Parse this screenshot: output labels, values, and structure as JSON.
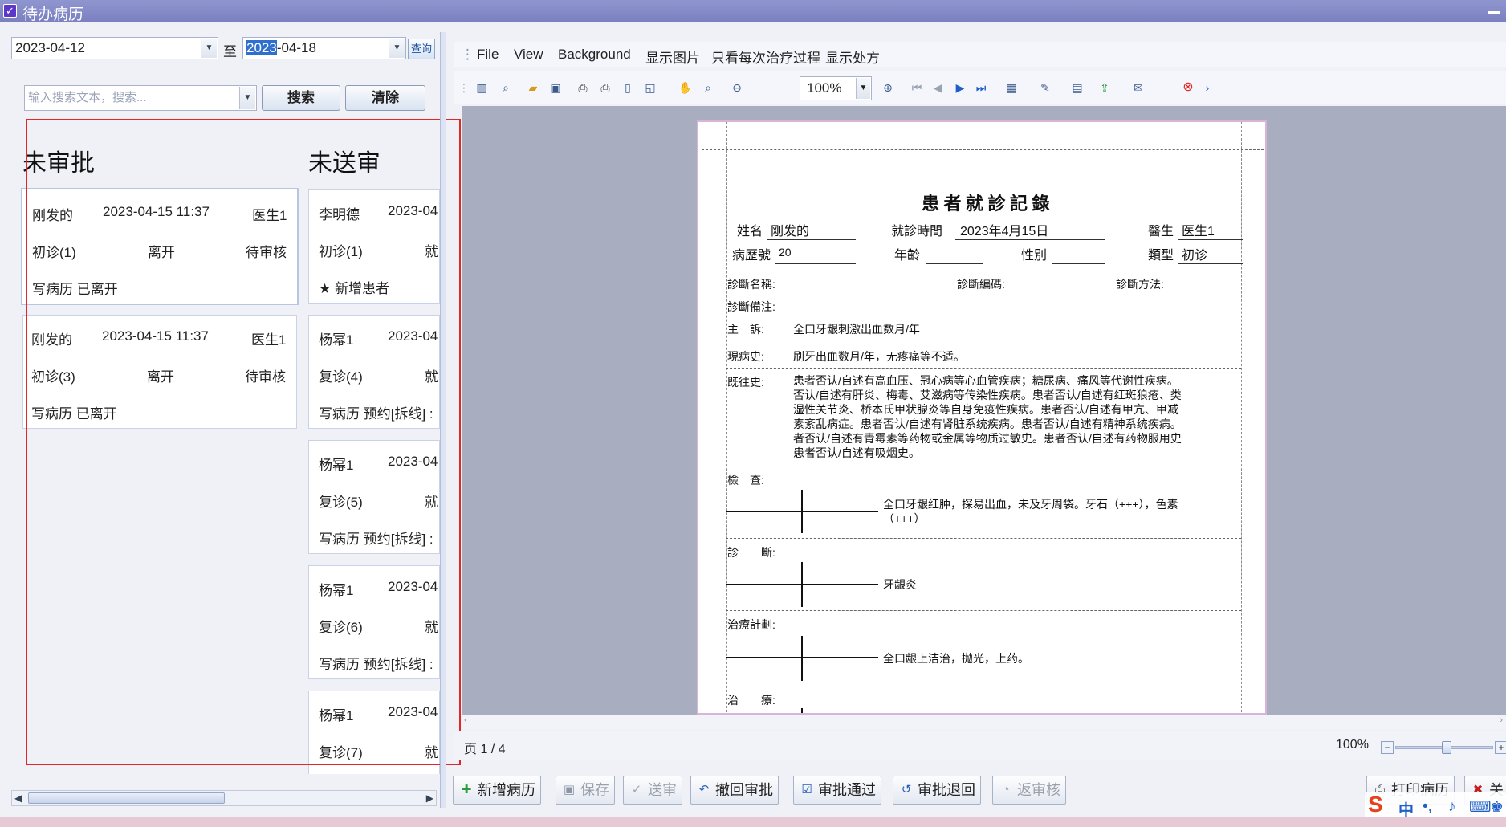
{
  "window": {
    "title": "待办病历"
  },
  "filter": {
    "date_from": "2023-04-12",
    "to_label": "至",
    "date_to_selected": "2023",
    "date_to_rest": "-04-18",
    "query_btn": "查询",
    "search_placeholder": "输入搜索文本，搜索...",
    "search_btn": "搜索",
    "clear_btn": "清除"
  },
  "columns": {
    "unapproved": {
      "title": "未审批",
      "cards": [
        {
          "name": "刚发的",
          "time": "2023-04-15 11:37",
          "doctor": "医生1",
          "visit": "初诊(1)",
          "state": "离开",
          "status": "待审核",
          "note": "写病历 已离开"
        },
        {
          "name": "刚发的",
          "time": "2023-04-15 11:37",
          "doctor": "医生1",
          "visit": "初诊(3)",
          "state": "离开",
          "status": "待审核",
          "note": "写病历 已离开"
        }
      ]
    },
    "unsent": {
      "title": "未送审",
      "cards": [
        {
          "name": "李明德",
          "time": "2023-04",
          "visit": "初诊(1)",
          "state": "就",
          "note": "★ 新增患者"
        },
        {
          "name": "杨幂1",
          "time": "2023-04",
          "visit": "复诊(4)",
          "state": "就",
          "note": "写病历 预约[拆线] :"
        },
        {
          "name": "杨幂1",
          "time": "2023-04",
          "visit": "复诊(5)",
          "state": "就",
          "note": "写病历 预约[拆线] :"
        },
        {
          "name": "杨幂1",
          "time": "2023-04",
          "visit": "复诊(6)",
          "state": "就",
          "note": "写病历 预约[拆线] :"
        },
        {
          "name": "杨幂1",
          "time": "2023-04",
          "visit": "复诊(7)",
          "state": "就"
        }
      ]
    }
  },
  "viewer": {
    "menu": [
      "File",
      "View",
      "Background",
      "显示图片",
      "只看每次治疗过程",
      "显示处方"
    ],
    "zoom": "100%",
    "page_status": "页 1 / 4",
    "zoom_status": "100%"
  },
  "record": {
    "title": "患 者 就 診 記 錄",
    "name_label": "姓名",
    "name": "刚发的",
    "visit_time_label": "就診時間",
    "visit_time": "2023年4月15日",
    "doctor_label": "醫生",
    "doctor": "医生1",
    "record_no_label": "病歷號",
    "record_no": "20",
    "age_label": "年齡",
    "gender_label": "性別",
    "type_label": "類型",
    "type": "初诊",
    "diag_name_label": "診斷名稱:",
    "diag_code_label": "診斷編碼:",
    "diag_method_label": "診斷方法:",
    "diag_note_label": "診斷備注:",
    "chief_label": "主　訴:",
    "chief": "全口牙龈刺激出血数月/年",
    "present_label": "現病史:",
    "present": "刷牙出血数月/年，无疼痛等不适。",
    "past_label": "既往史:",
    "past": [
      "患者否认/自述有高血压、冠心病等心血管疾病；糖尿病、痛风等代谢性疾病。",
      "否认/自述有肝炎、梅毒、艾滋病等传染性疾病。患者否认/自述有红斑狼疮、类",
      "湿性关节炎、桥本氏甲状腺炎等自身免疫性疾病。患者否认/自述有甲亢、甲减",
      "素紊乱病症。患者否认/自述有肾脏系统疾病。患者否认/自述有精神系统疾病。",
      "者否认/自述有青霉素等药物或金属等物质过敏史。患者否认/自述有药物服用史",
      "患者否认/自述有吸烟史。"
    ],
    "exam_label": "檢　查:",
    "exam_1": "全口牙龈红肿，探易出血，未及牙周袋。牙石（+++），色素",
    "exam_2": "（+++）",
    "diag_label": "診　　斷:",
    "diag": "牙龈炎",
    "plan_label": "治療計劃:",
    "plan": "全口龈上洁治，抛光，上药。",
    "treat_label": "治　　療:"
  },
  "actions": [
    {
      "label": "新增病历",
      "icon": "new-record-icon",
      "glyph": "✚",
      "color": "#2c9c3a",
      "disabled": false
    },
    {
      "label": "保存",
      "icon": "save-icon",
      "glyph": "▣",
      "color": "#8c96a6",
      "disabled": true
    },
    {
      "label": "送审",
      "icon": "send-review-icon",
      "glyph": "✓",
      "color": "#a0a8b4",
      "disabled": true
    },
    {
      "label": "撤回审批",
      "icon": "undo-icon",
      "glyph": "↶",
      "color": "#2a60b8",
      "disabled": false
    },
    {
      "label": "审批通过",
      "icon": "approve-icon",
      "glyph": "☑",
      "color": "#2a60b8",
      "disabled": false
    },
    {
      "label": "审批退回",
      "icon": "return-icon",
      "glyph": "↺",
      "color": "#2a60b8",
      "disabled": false
    },
    {
      "label": "返审核",
      "icon": "back-review-icon",
      "glyph": "◔",
      "color": "#a0a8b4",
      "disabled": true
    },
    {
      "label": "打印病历",
      "icon": "print-icon",
      "glyph": "⎙",
      "color": "#333",
      "disabled": false
    },
    {
      "label": "关",
      "icon": "close-icon",
      "glyph": "✖",
      "color": "#c02020",
      "disabled": false
    }
  ],
  "colors": {
    "accent": "#2f6fd0",
    "highlight_border": "#e02828",
    "title_bar": "#8f96cf"
  }
}
